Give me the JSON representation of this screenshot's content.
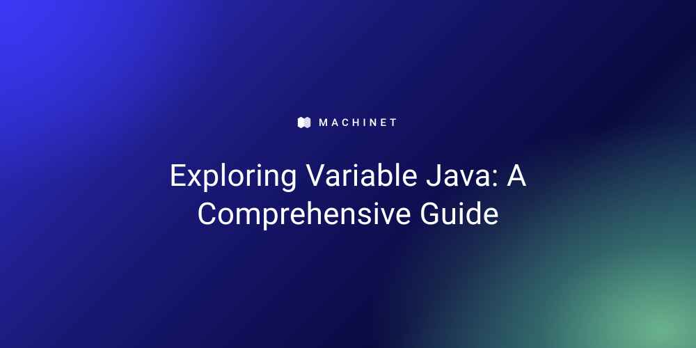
{
  "brand": {
    "name": "MACHINET"
  },
  "title": "Exploring Variable Java: A Comprehensive Guide"
}
